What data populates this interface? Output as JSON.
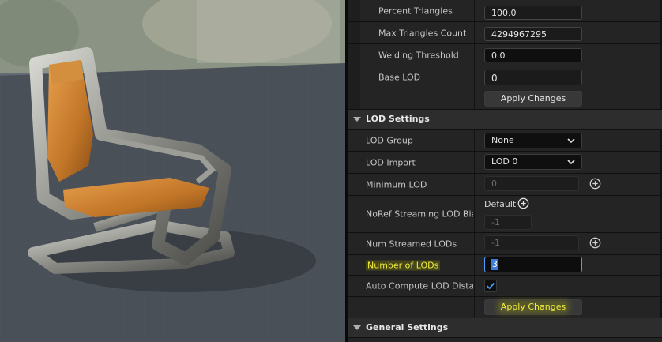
{
  "reduction": {
    "rows": [
      {
        "id": "percent-triangles",
        "label": "Percent Triangles",
        "value": "100.0"
      },
      {
        "id": "max-triangles-count",
        "label": "Max Triangles Count",
        "value": "4294967295"
      },
      {
        "id": "welding-threshold",
        "label": "Welding Threshold",
        "value": "0.0"
      },
      {
        "id": "base-lod",
        "label": "Base LOD",
        "value": "0"
      }
    ],
    "apply_label": "Apply Changes"
  },
  "lod_settings": {
    "title": "LOD Settings",
    "lod_group": {
      "label": "LOD Group",
      "value": "None"
    },
    "lod_import": {
      "label": "LOD Import",
      "value": "LOD 0"
    },
    "minimum_lod": {
      "label": "Minimum LOD",
      "value": "0"
    },
    "noref_streaming": {
      "label": "NoRef Streaming LOD Bias",
      "platform": "Default",
      "value": "-1"
    },
    "num_streamed": {
      "label": "Num Streamed LODs",
      "value": "-1"
    },
    "number_of_lods": {
      "label": "Number of LODs",
      "value": "3"
    },
    "auto_compute": {
      "label": "Auto Compute LOD Distances",
      "checked": true
    },
    "apply_label": "Apply Changes"
  },
  "general_settings": {
    "title": "General Settings"
  },
  "colors": {
    "accent": "#4a9cff",
    "highlight": "#f1ee3b"
  }
}
